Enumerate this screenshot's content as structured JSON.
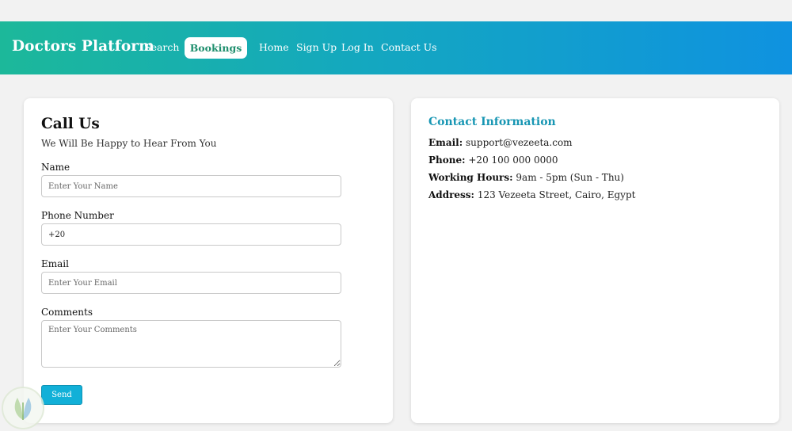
{
  "nav": {
    "brand": "Doctors Platform",
    "links": [
      "Search",
      "Bookings",
      "Home",
      "Sign Up",
      "Log In",
      "Contact Us"
    ],
    "active": "Bookings"
  },
  "form": {
    "title": "Call Us",
    "subtitle": "We Will Be Happy to Hear From You",
    "name_label": "Name",
    "name_placeholder": "Enter Your Name",
    "phone_label": "Phone Number",
    "phone_value": "+20",
    "email_label": "Email",
    "email_placeholder": "Enter Your Email",
    "comments_label": "Comments",
    "comments_placeholder": "Enter Your Comments",
    "send_label": "Send"
  },
  "contact": {
    "title": "Contact Information",
    "email_label": "Email:",
    "email_value": "support@vezeeta.com",
    "phone_label": "Phone:",
    "phone_value": "+20 100 000 0000",
    "hours_label": "Working Hours:",
    "hours_value": "9am - 5pm (Sun - Thu)",
    "address_label": "Address:",
    "address_value": "123 Vezeeta Street, Cairo, Egypt"
  },
  "colors": {
    "nav_gradient_start": "#1cb89a",
    "nav_gradient_end": "#0f92e0",
    "active_tab_text": "#1f8f6e",
    "info_title": "#1796b3",
    "send_button": "#12b0d8"
  }
}
